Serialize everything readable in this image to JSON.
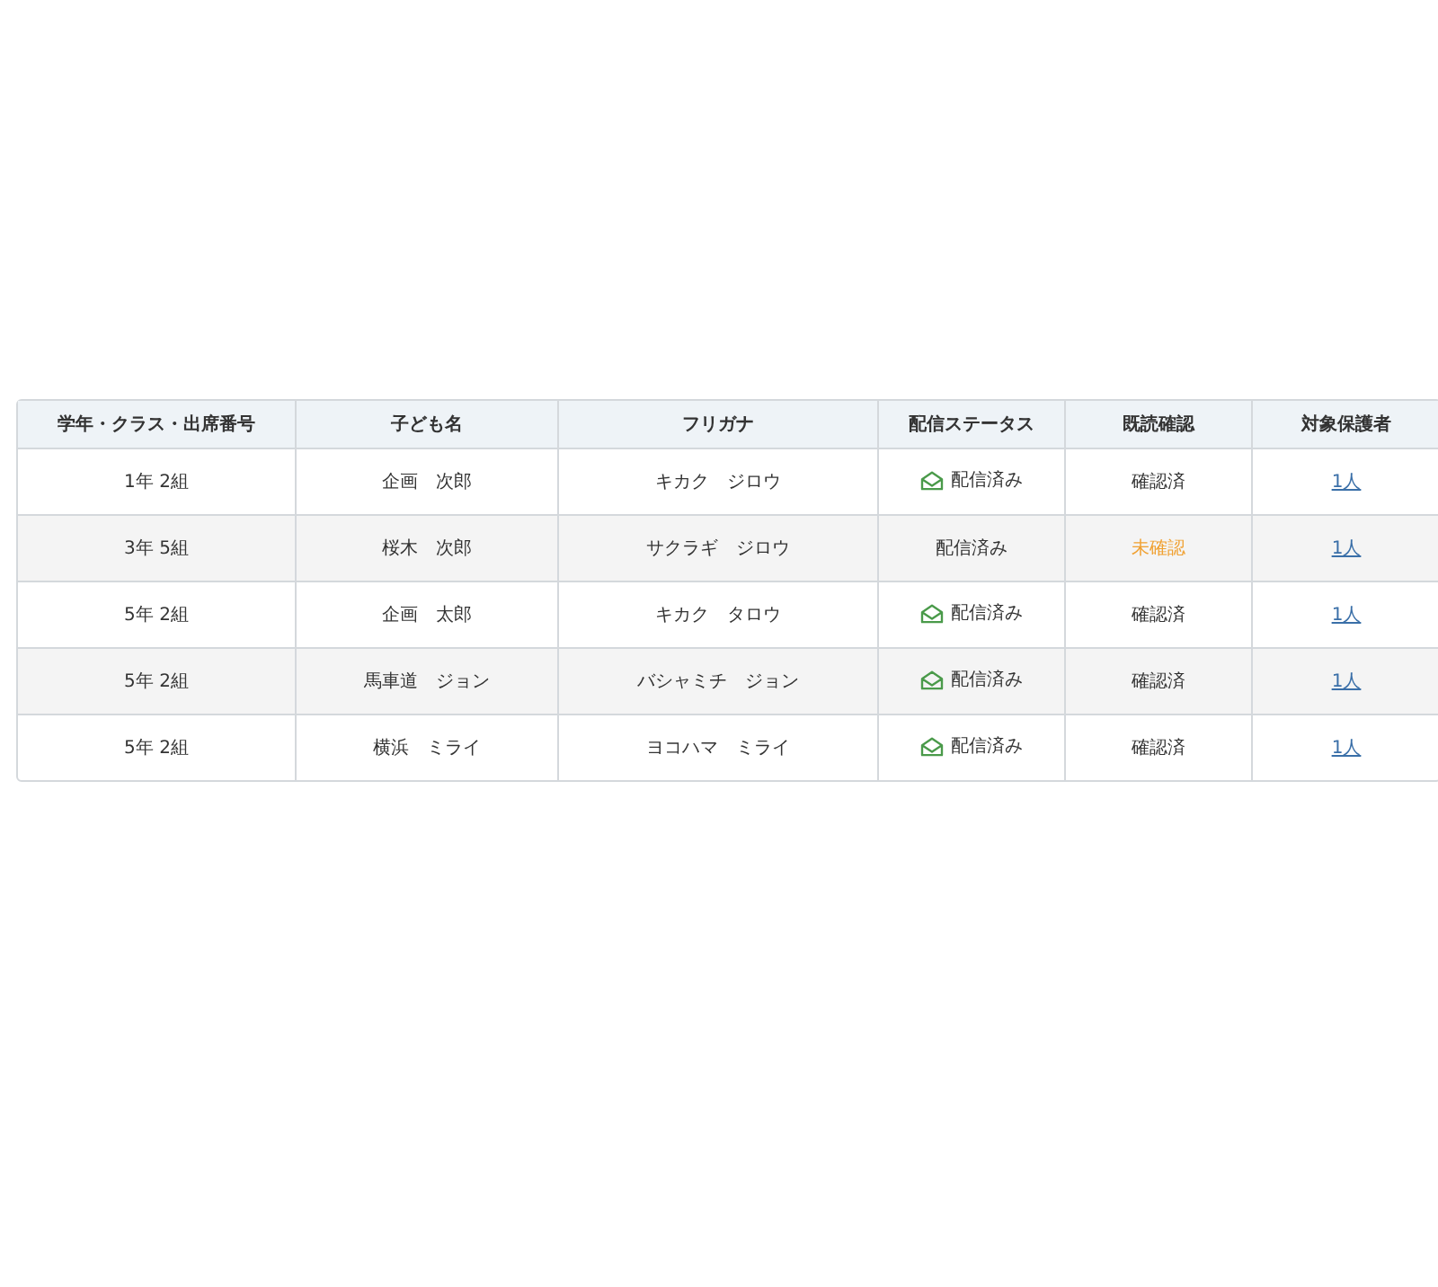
{
  "table": {
    "columns": [
      "学年・クラス・出席番号",
      "子ども名",
      "フリガナ",
      "配信ステータス",
      "既読確認",
      "対象保護者"
    ],
    "rows": [
      {
        "class": "1年 2組",
        "name": "企画　次郎",
        "furigana": "キカク　ジロウ",
        "delivery": {
          "text": "配信済み",
          "opened": true
        },
        "read": {
          "text": "確認済",
          "confirmed": true
        },
        "guardians": "1人"
      },
      {
        "class": "3年 5組",
        "name": "桜木　次郎",
        "furigana": "サクラギ　ジロウ",
        "delivery": {
          "text": "配信済み",
          "opened": false
        },
        "read": {
          "text": "未確認",
          "confirmed": false
        },
        "guardians": "1人"
      },
      {
        "class": "5年 2組",
        "name": "企画　太郎",
        "furigana": "キカク　タロウ",
        "delivery": {
          "text": "配信済み",
          "opened": true
        },
        "read": {
          "text": "確認済",
          "confirmed": true
        },
        "guardians": "1人"
      },
      {
        "class": "5年 2組",
        "name": "馬車道　ジョン",
        "furigana": "バシャミチ　ジョン",
        "delivery": {
          "text": "配信済み",
          "opened": true
        },
        "read": {
          "text": "確認済",
          "confirmed": true
        },
        "guardians": "1人"
      },
      {
        "class": "5年 2組",
        "name": "横浜　ミライ",
        "furigana": "ヨコハマ　ミライ",
        "delivery": {
          "text": "配信済み",
          "opened": true
        },
        "read": {
          "text": "確認済",
          "confirmed": true
        },
        "guardians": "1人"
      }
    ]
  }
}
